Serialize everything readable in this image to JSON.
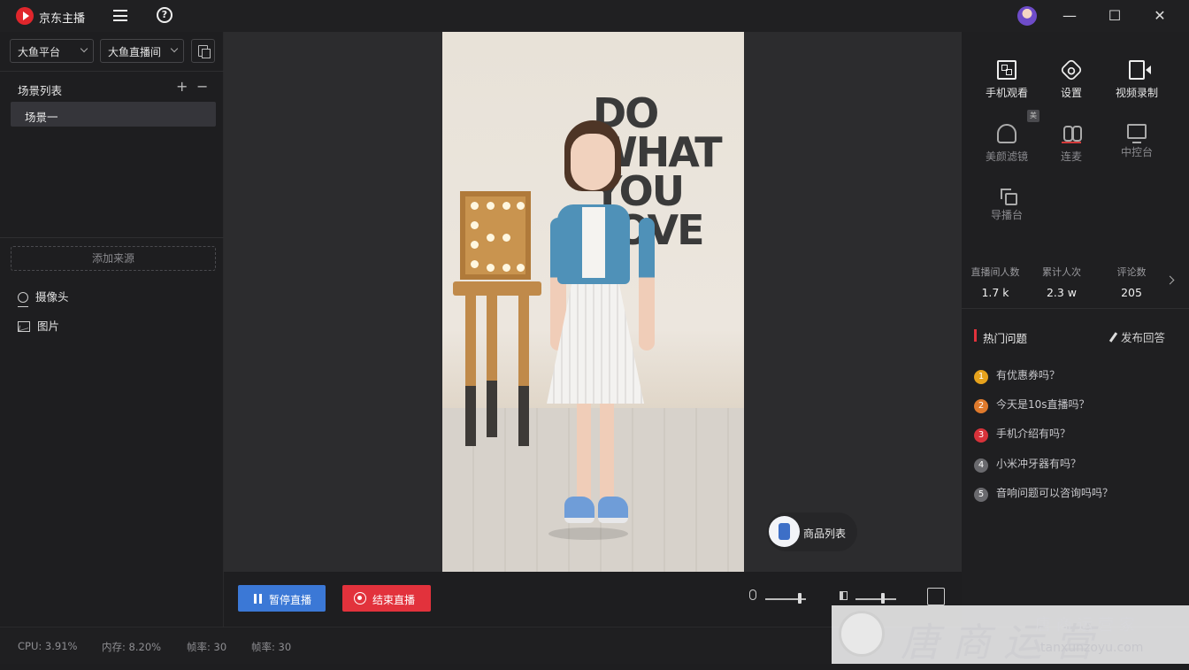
{
  "app": {
    "title": "京东主播"
  },
  "left": {
    "platform_select": "大鱼平台",
    "room_select": "大鱼直播间",
    "scene_list_title": "场景列表",
    "scene_add": "+",
    "scene_remove": "−",
    "scenes": [
      "场景一"
    ],
    "add_source_label": "添加来源",
    "sources": [
      {
        "label": "摄像头",
        "icon": "camera-icon"
      },
      {
        "label": "图片",
        "icon": "image-icon"
      }
    ]
  },
  "stage": {
    "wall_text": [
      "DO",
      "WHAT",
      "YOU",
      "LOVE"
    ],
    "goods_button_label": "商品列表"
  },
  "controls": {
    "pause_label": "暂停直播",
    "end_label": "结束直播",
    "mic_level": 0.85,
    "speaker_level": 0.85
  },
  "status": {
    "cpu": "CPU: 3.91%",
    "memory": "内存: 8.20%",
    "fps1": "帧率: 30",
    "fps2": "帧率: 30"
  },
  "right": {
    "tools": [
      {
        "label": "手机观看",
        "icon": "qr-code-icon",
        "enabled": true
      },
      {
        "label": "设置",
        "icon": "settings-icon",
        "enabled": true
      },
      {
        "label": "视频录制",
        "icon": "video-record-icon",
        "enabled": true
      },
      {
        "label": "美颜滤镜",
        "icon": "beauty-filter-icon",
        "enabled": false,
        "badge": "美"
      },
      {
        "label": "连麦",
        "icon": "co-host-icon",
        "enabled": false
      },
      {
        "label": "中控台",
        "icon": "control-console-icon",
        "enabled": false
      },
      {
        "label": "导播台",
        "icon": "director-icon",
        "enabled": false
      }
    ],
    "stats": [
      {
        "label": "直播间人数",
        "value": "1.7 k"
      },
      {
        "label": "累计人次",
        "value": "2.3 w"
      },
      {
        "label": "评论数",
        "value": "205"
      }
    ],
    "hot_title": "热门问题",
    "answer_label": "发布回答",
    "questions": [
      {
        "n": "1",
        "text": "有优惠券吗？",
        "color": "#e6a21c"
      },
      {
        "n": "2",
        "text": "今天是10s直播吗？",
        "color": "#e07a2c"
      },
      {
        "n": "3",
        "text": "手机介绍有吗？",
        "color": "#d8323a"
      },
      {
        "n": "4",
        "text": "小米冲牙器有吗？",
        "color": "#6a6a6e"
      },
      {
        "n": "5",
        "text": "音响问题可以咨询吗吗？",
        "color": "#6a6a6e"
      }
    ]
  },
  "watermark": {
    "text": "唐商运营",
    "sub": "唐 商 运 营 家",
    "url": "tanxunzoyu.com"
  }
}
